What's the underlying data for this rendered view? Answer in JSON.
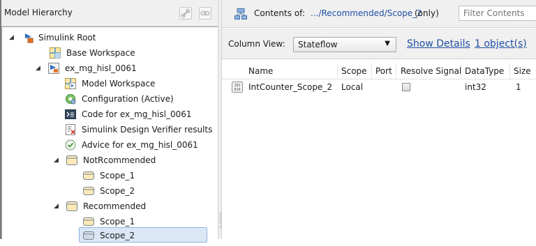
{
  "left": {
    "title": "Model Hierarchy",
    "icons": [
      "link-icon",
      "chain-icon"
    ],
    "tree": [
      {
        "label": "Simulink Root",
        "icon": "simulink-root-icon",
        "expanded": true
      },
      {
        "label": "Base Workspace",
        "icon": "workspace-grid-icon"
      },
      {
        "label": "ex_mg_hisl_0061",
        "icon": "model-icon",
        "expanded": true
      },
      {
        "label": "Model Workspace",
        "icon": "model-workspace-icon"
      },
      {
        "label": "Configuration (Active)",
        "icon": "configuration-gear-icon"
      },
      {
        "label": "Code for ex_mg_hisl_0061",
        "icon": "code-terminal-icon"
      },
      {
        "label": "Simulink Design Verifier results",
        "icon": "verifier-results-icon"
      },
      {
        "label": "Advice for ex_mg_hisl_0061",
        "icon": "advice-check-icon"
      },
      {
        "label": "NotRcommended",
        "icon": "stateflow-chart-icon",
        "expanded": true
      },
      {
        "label": "Scope_1",
        "icon": "stateflow-state-icon"
      },
      {
        "label": "Scope_2",
        "icon": "stateflow-state-icon"
      },
      {
        "label": "Recommended",
        "icon": "stateflow-chart-icon",
        "expanded": true
      },
      {
        "label": "Scope_1",
        "icon": "stateflow-state-icon"
      },
      {
        "label": "Scope_2",
        "icon": "stateflow-state-icon",
        "selected": true
      }
    ]
  },
  "right": {
    "contents_label": "Contents of:",
    "contents_path": ".../Recommended/Scope_2",
    "contents_scope": "(only)",
    "filter_placeholder": "Filter Contents",
    "column_view_label": "Column View:",
    "column_view_value": "Stateflow",
    "show_details": "Show Details",
    "object_count": "1 object(s)",
    "columns": [
      "Name",
      "Scope",
      "Port",
      "Resolve Signal",
      "DataType",
      "Size"
    ],
    "rows": [
      {
        "name": "IntCounter_Scope_2",
        "scope": "Local",
        "port": "",
        "resolve_signal": false,
        "datatype": "int32",
        "size": "1"
      }
    ]
  }
}
